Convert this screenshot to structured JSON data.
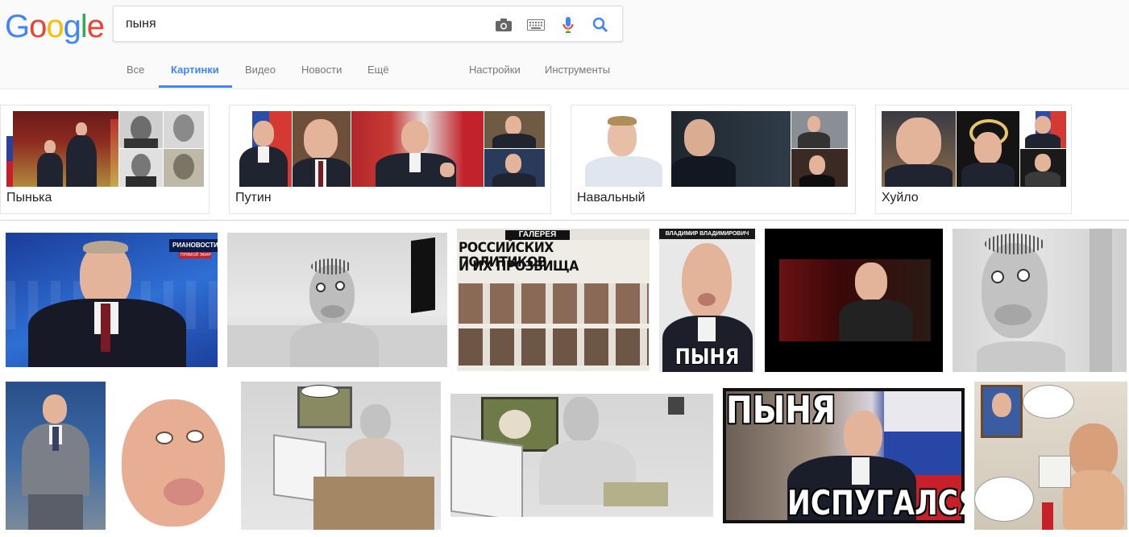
{
  "search": {
    "query": "пыня"
  },
  "logo": {
    "letters": [
      "G",
      "o",
      "o",
      "g",
      "l",
      "e"
    ],
    "colors": [
      "#4285f4",
      "#ea4335",
      "#fbbc05",
      "#4285f4",
      "#34a853",
      "#ea4335"
    ]
  },
  "tabs": [
    {
      "label": "Все"
    },
    {
      "label": "Картинки"
    },
    {
      "label": "Видео"
    },
    {
      "label": "Новости"
    },
    {
      "label": "Ещё"
    },
    {
      "label": "Настройки"
    },
    {
      "label": "Инструменты"
    }
  ],
  "active_tab": "Картинки",
  "related": [
    {
      "label": "Пынька"
    },
    {
      "label": "Путин"
    },
    {
      "label": "Навальный"
    },
    {
      "label": "Хуйло"
    }
  ],
  "results": {
    "ria_overlay": "РИАНОВОСТИ",
    "ria_sub": "ПРЯМОЙ ЭФИР",
    "gallery_header": "ГАЛЕРЕЯ",
    "gallery_title_1": "РОССИЙСКИХ ПОЛИТИКОВ",
    "gallery_title_2": "И ИХ ПРОЗВИЩА",
    "vv_caption": "ВЛАДИМИР ВЛАДИМИРОВИЧ",
    "vv_bottom": "ПЫНЯ",
    "meme_top": "ПЫНЯ",
    "meme_bottom": "ИСПУГАЛСЯ"
  },
  "colors": {
    "accent": "#4285f4",
    "tab_text": "#777777",
    "header_bg": "#fafafa"
  },
  "icons": [
    "camera-icon",
    "keyboard-icon",
    "microphone-icon",
    "search-icon"
  ]
}
